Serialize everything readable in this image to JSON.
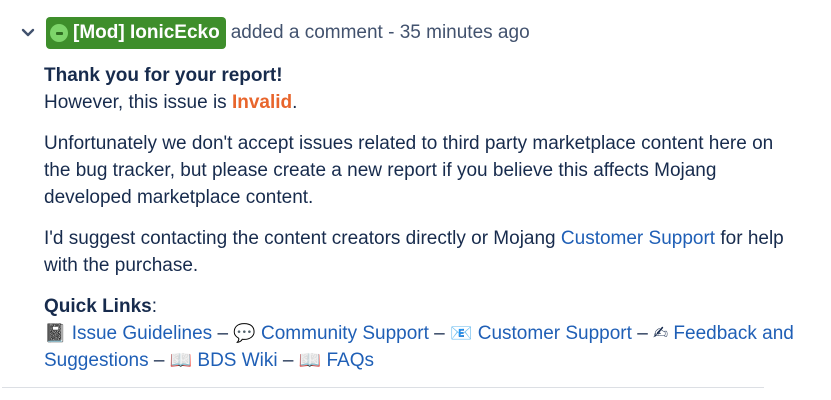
{
  "comment": {
    "author": "[Mod] IonicEcko",
    "action": "added a comment - 35 minutes ago",
    "thanks": "Thank you for your report!",
    "invalid_prefix": "However, this issue is ",
    "invalid_word": "Invalid",
    "invalid_suffix": ".",
    "paragraph1": "Unfortunately we don't accept issues related to third party marketplace content here on the bug tracker, but please create a new report if you believe this affects Mojang developed marketplace content.",
    "suggest_prefix": "I'd suggest contacting the content creators directly or Mojang ",
    "suggest_link": "Customer Support",
    "suggest_suffix": " for help with the purchase.",
    "quick_links_label": "Quick Links",
    "quick_links_colon": ":",
    "separator": " – ",
    "links": [
      {
        "emoji": "📓",
        "label": "Issue Guidelines"
      },
      {
        "emoji": "💬",
        "label": "Community Support"
      },
      {
        "emoji": "📧",
        "label": "Customer Support"
      },
      {
        "emoji": "✍",
        "label": "Feedback and Suggestions"
      },
      {
        "emoji": "📖",
        "label": "BDS Wiki"
      },
      {
        "emoji": "📖",
        "label": "FAQs"
      }
    ]
  },
  "colors": {
    "badge_bg": "#3e8e2b",
    "invalid": "#e8652c",
    "link": "#1f5fb6",
    "text": "#172b4d"
  },
  "icons": {
    "toggle": "chevron-down-icon",
    "status": "status-dot-icon"
  }
}
